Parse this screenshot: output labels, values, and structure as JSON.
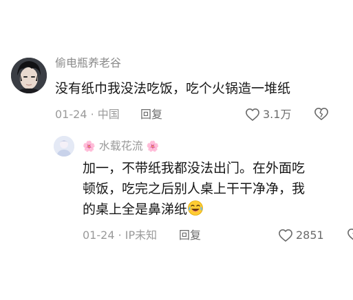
{
  "comments": [
    {
      "username": "偷电瓶养老谷",
      "text": "没有纸巾我没法吃饭，吃个火锅造一堆纸",
      "date": "01-24 · 中国",
      "reply_label": "回复",
      "likes": "3.1万",
      "avatar_icon": "anime-man-avatar"
    },
    {
      "username": "水载花流",
      "username_deco_left": "🌸",
      "username_deco_right": "🌸",
      "text_lines": [
        "加一，不带纸我都没法出门。在外面吃",
        "顿饭，吃完之后别人桌上干干净净，我",
        "的桌上全是鼻涕纸"
      ],
      "trailing_emoji": "laugh-cry-emoji",
      "date": "01-24 · IP未知",
      "reply_label": "回复",
      "likes": "2851",
      "avatar_icon": "pastel-avatar"
    }
  ],
  "icons": {
    "like": "heart-outline-icon",
    "dislike": "broken-heart-icon"
  },
  "colors": {
    "meta_text": "#9a9a9a",
    "body_text": "#161616",
    "icon": "#6a6a6a"
  }
}
